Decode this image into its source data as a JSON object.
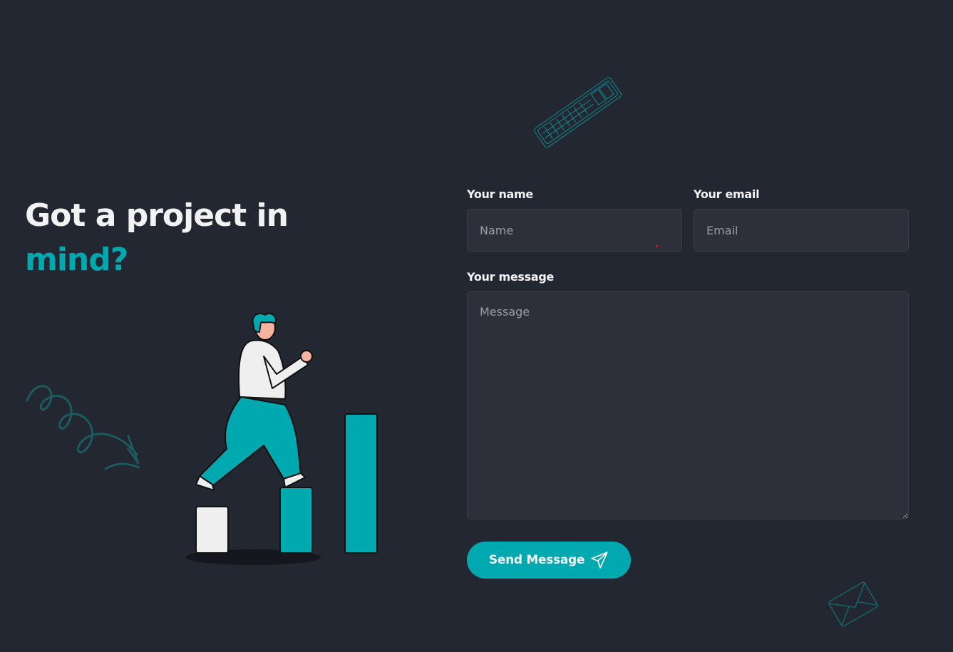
{
  "heading": {
    "line1": "Got a project in",
    "line2": "mind?"
  },
  "form": {
    "name_label": "Your name",
    "name_placeholder": "Name",
    "email_label": "Your email",
    "email_placeholder": "Email",
    "message_label": "Your message",
    "message_placeholder": "Message",
    "send_label": "Send Message"
  },
  "icons": {
    "send": "paper-plane-icon",
    "scribble": "scribble-arrow-icon",
    "keyboard": "keyboard-doodle-icon",
    "envelope": "envelope-doodle-icon"
  },
  "colors": {
    "background": "#222731",
    "accent": "#00a8b0",
    "input_bg": "#2d303a",
    "text": "#f2f2f2"
  }
}
